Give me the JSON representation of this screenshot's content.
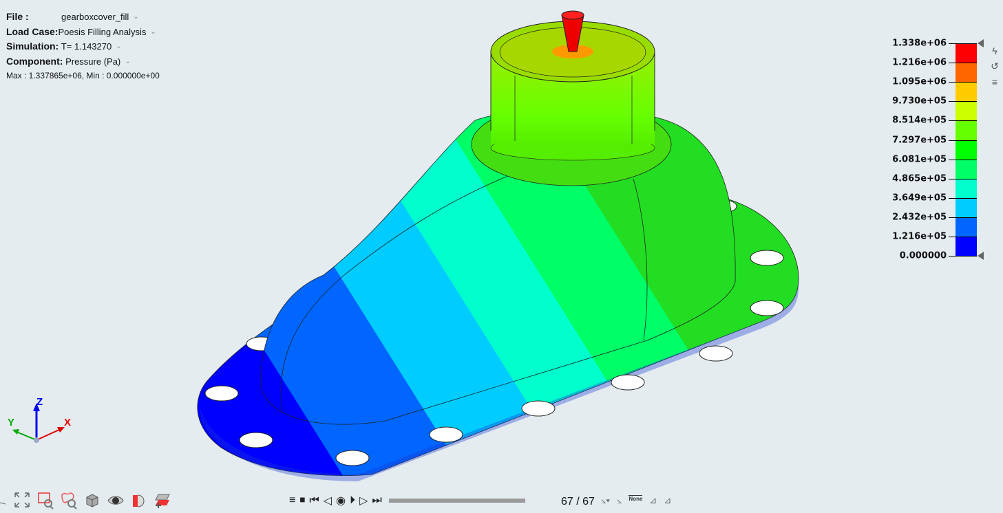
{
  "info": {
    "file_label": "File :",
    "file_value": "gearboxcover_fill",
    "loadcase_label": "Load Case:",
    "loadcase_value": "Poesis Filling Analysis",
    "simulation_label": "Simulation:",
    "simulation_value": "T= 1.143270",
    "component_label": "Component:",
    "component_value": "Pressure (Pa)",
    "maxmin": "Max : 1.337865e+06, Min : 0.000000e+00"
  },
  "legend": {
    "labels": [
      "1.338e+06",
      "1.216e+06",
      "1.095e+06",
      "9.730e+05",
      "8.514e+05",
      "7.297e+05",
      "6.081e+05",
      "4.865e+05",
      "3.649e+05",
      "2.432e+05",
      "1.216e+05",
      "0.000000"
    ],
    "colors": [
      "#ff0000",
      "#ff6600",
      "#ffcc00",
      "#ccff00",
      "#66ff00",
      "#00ff00",
      "#00ff66",
      "#00ffcc",
      "#00ccff",
      "#0066ff",
      "#0000ff"
    ]
  },
  "axes": {
    "x": "X",
    "y": "Y",
    "z": "Z"
  },
  "player": {
    "frame": "67 / 67",
    "progress": 1.0,
    "none_label": "None"
  }
}
